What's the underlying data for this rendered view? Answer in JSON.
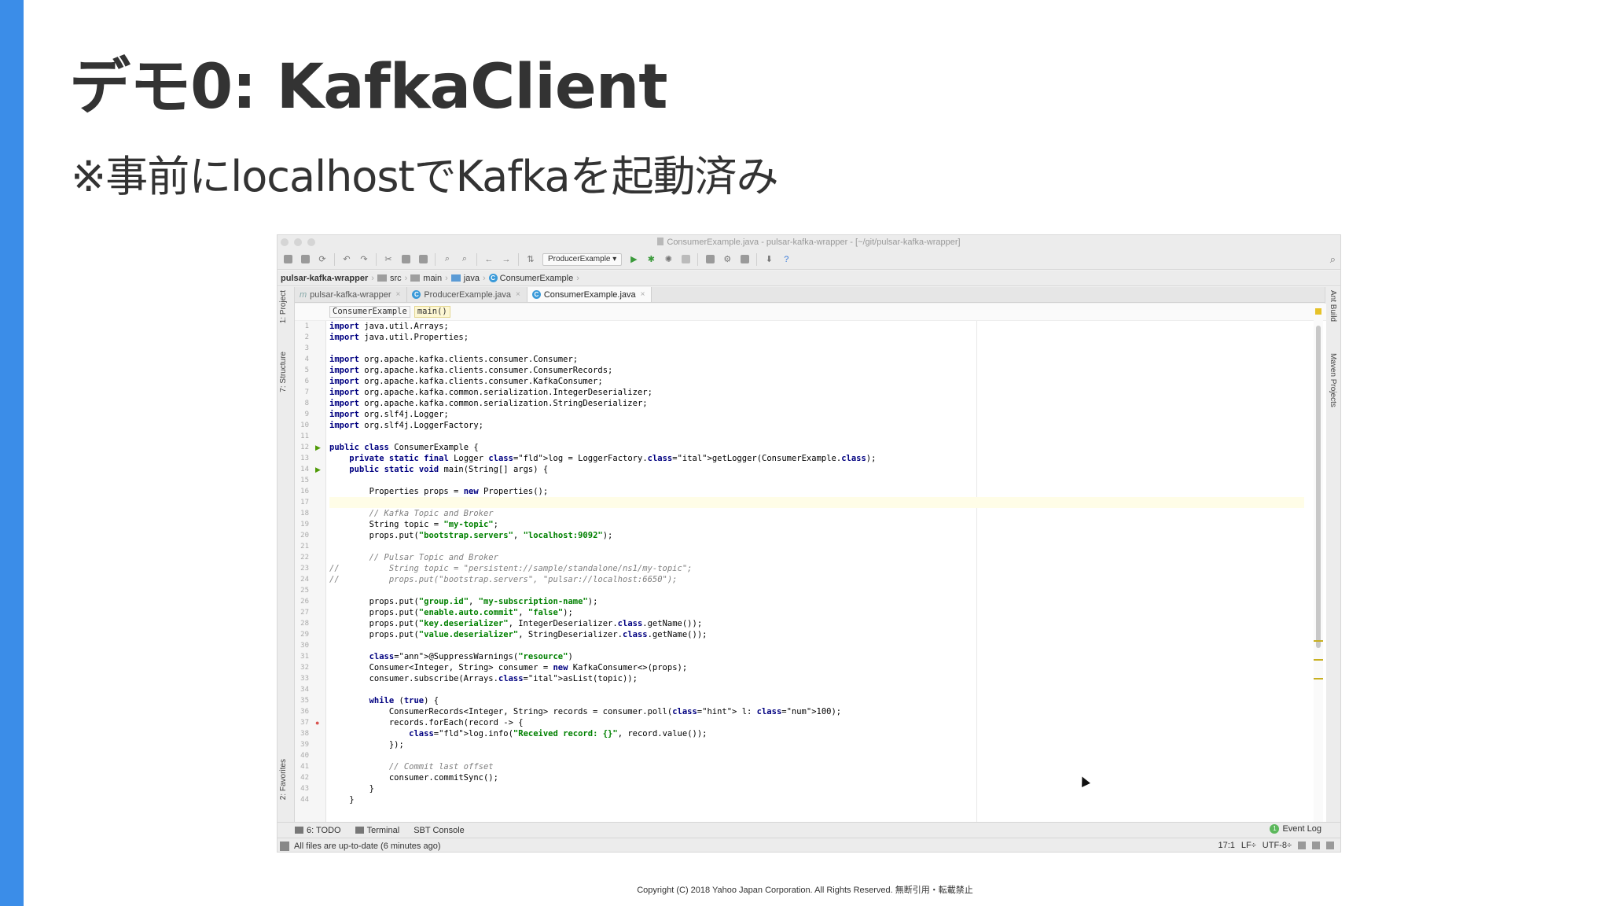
{
  "slide": {
    "title": "デモ0: KafkaClient",
    "subtitle": "※事前にlocalhostでKafkaを起動済み",
    "copyright": "Copyright (C) 2018 Yahoo Japan Corporation. All Rights Reserved. 無断引用・転載禁止",
    "accent_color": "#3b8de8"
  },
  "ide": {
    "window_title": "ConsumerExample.java - pulsar-kafka-wrapper - [~/git/pulsar-kafka-wrapper]",
    "run_config": "ProducerExample",
    "breadcrumbs": [
      "pulsar-kafka-wrapper",
      "src",
      "main",
      "java",
      "ConsumerExample"
    ],
    "tabs": [
      {
        "label": "pulsar-kafka-wrapper",
        "icon": "module-icon",
        "active": false
      },
      {
        "label": "ProducerExample.java",
        "icon": "class-icon",
        "active": false
      },
      {
        "label": "ConsumerExample.java",
        "icon": "class-icon",
        "active": true
      }
    ],
    "left_tool_windows": [
      "1: Project",
      "7: Structure",
      "2: Favorites"
    ],
    "right_tool_windows": [
      "Ant Build",
      "Maven Projects"
    ],
    "editor_breadcrumb": {
      "class": "ConsumerExample",
      "method": "main()"
    },
    "line_numbers": [
      "1",
      "2",
      "3",
      "4",
      "5",
      "6",
      "7",
      "8",
      "9",
      "10",
      "11",
      "12",
      "13",
      "14",
      "15",
      "16",
      "17",
      "18",
      "19",
      "20",
      "21",
      "22",
      "23",
      "24",
      "25",
      "26",
      "27",
      "28",
      "29",
      "30",
      "31",
      "32",
      "33",
      "34",
      "35",
      "36",
      "37",
      "38",
      "39",
      "40",
      "41",
      "42",
      "43",
      "44"
    ],
    "current_line": 17,
    "code_lines": [
      "import java.util.Arrays;",
      "import java.util.Properties;",
      "",
      "import org.apache.kafka.clients.consumer.Consumer;",
      "import org.apache.kafka.clients.consumer.ConsumerRecords;",
      "import org.apache.kafka.clients.consumer.KafkaConsumer;",
      "import org.apache.kafka.common.serialization.IntegerDeserializer;",
      "import org.apache.kafka.common.serialization.StringDeserializer;",
      "import org.slf4j.Logger;",
      "import org.slf4j.LoggerFactory;",
      "",
      "public class ConsumerExample {",
      "    private static final Logger log = LoggerFactory.getLogger(ConsumerExample.class);",
      "    public static void main(String[] args) {",
      "",
      "        Properties props = new Properties();",
      "",
      "        // Kafka Topic and Broker",
      "        String topic = \"my-topic\";",
      "        props.put(\"bootstrap.servers\", \"localhost:9092\");",
      "",
      "        // Pulsar Topic and Broker",
      "//          String topic = \"persistent://sample/standalone/ns1/my-topic\";",
      "//          props.put(\"bootstrap.servers\", \"pulsar://localhost:6650\");",
      "",
      "        props.put(\"group.id\", \"my-subscription-name\");",
      "        props.put(\"enable.auto.commit\", \"false\");",
      "        props.put(\"key.deserializer\", IntegerDeserializer.class.getName());",
      "        props.put(\"value.deserializer\", StringDeserializer.class.getName());",
      "",
      "        @SuppressWarnings(\"resource\")",
      "        Consumer<Integer, String> consumer = new KafkaConsumer<>(props);",
      "        consumer.subscribe(Arrays.asList(topic));",
      "",
      "        while (true) {",
      "            ConsumerRecords<Integer, String> records = consumer.poll( l: 100);",
      "            records.forEach(record -> {",
      "                log.info(\"Received record: {}\", record.value());",
      "            });",
      "",
      "            // Commit last offset",
      "            consumer.commitSync();",
      "        }",
      "    }"
    ],
    "bottom_tabs": [
      "6: TODO",
      "Terminal",
      "SBT Console"
    ],
    "event_log": "Event Log",
    "status_message": "All files are up-to-date (6 minutes ago)",
    "cursor_position": "17:1",
    "line_separator": "LF÷",
    "encoding": "UTF-8÷"
  }
}
